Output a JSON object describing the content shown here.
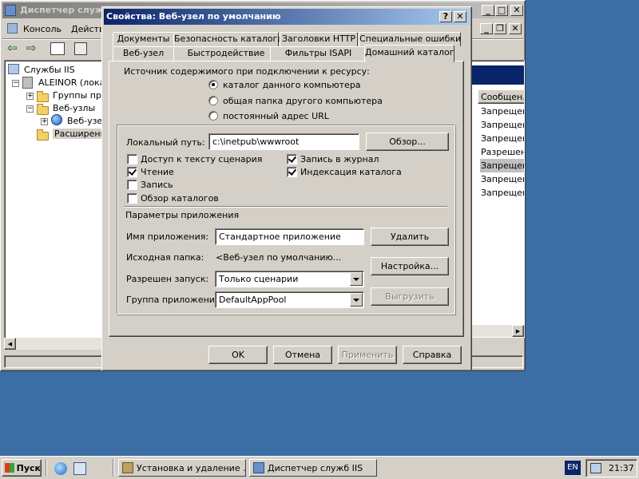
{
  "iis_window": {
    "title": "Диспетчер служб IIS",
    "menu": {
      "console": "Консоль",
      "action": "Действ"
    },
    "tree": {
      "root": "Службы IIS",
      "server": "ALEINOR (локал",
      "app_pools": "Группы при",
      "websites": "Веб-узлы",
      "default_site": "Веб-узел",
      "extensions": "Расширения"
    },
    "list": {
      "column_header": "Сообщен...",
      "rows": [
        "Запрещено",
        "Запрещено",
        "Запрещено",
        "Разрешено",
        "Запрещено",
        "Запрещено",
        "Запрещено"
      ]
    }
  },
  "dialog": {
    "title": "Свойства: Веб-узел по умолчанию",
    "help_glyph": "?",
    "close_glyph": "✕",
    "tabs_back": [
      "Документы",
      "Безопасность каталога",
      "Заголовки HTTP",
      "Специальные ошибки"
    ],
    "tabs_front": [
      "Веб-узел",
      "Быстродействие",
      "Фильтры ISAPI",
      "Домашний каталог"
    ],
    "source_label": "Источник содержимого при подключении к ресурсу:",
    "radio_options": [
      "каталог данного компьютера",
      "общая папка другого компьютера",
      "постоянный адрес URL"
    ],
    "local_path_label": "Локальный путь:",
    "local_path_value": "c:\\inetpub\\wwwroot",
    "browse_button": "Обзор...",
    "checkboxes_left": [
      {
        "label": "Доступ к тексту сценария",
        "checked": false
      },
      {
        "label": "Чтение",
        "checked": true
      },
      {
        "label": "Запись",
        "checked": false
      },
      {
        "label": "Обзор каталогов",
        "checked": false
      }
    ],
    "checkboxes_right": [
      {
        "label": "Запись в журнал",
        "checked": true
      },
      {
        "label": "Индексация каталога",
        "checked": true
      }
    ],
    "app_params_label": "Параметры приложения",
    "app_name_label": "Имя приложения:",
    "app_name_value": "Стандартное приложение",
    "remove_button": "Удалить",
    "start_folder_label": "Исходная папка:",
    "start_folder_value": "<Веб-узел по умолчанию...",
    "config_button": "Настройка...",
    "execute_label": "Разрешен запуск:",
    "execute_value": "Только сценарии",
    "pool_label": "Группа приложений:",
    "pool_value": "DefaultAppPool",
    "unload_button": "Выгрузить",
    "ok_button": "OK",
    "cancel_button": "Отмена",
    "apply_button": "Применить",
    "help_button": "Справка"
  },
  "taskbar": {
    "start": "Пуск",
    "tasks": [
      "Установка и удаление ...",
      "Диспетчер служб IIS"
    ],
    "language": "EN",
    "clock": "21:37"
  }
}
